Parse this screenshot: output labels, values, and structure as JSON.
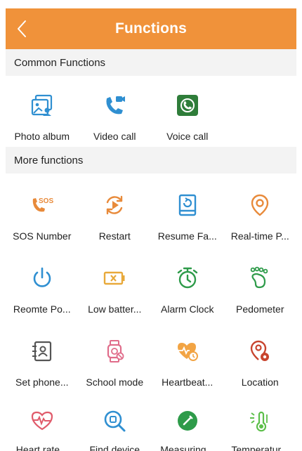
{
  "header": {
    "title": "Functions",
    "color": "#f0923a"
  },
  "sections": {
    "common": "Common Functions",
    "more": "More functions"
  },
  "common": [
    {
      "label": "Photo album",
      "icon": "photo-album-icon"
    },
    {
      "label": "Video call",
      "icon": "video-call-icon"
    },
    {
      "label": "Voice call",
      "icon": "voice-call-icon"
    }
  ],
  "more": [
    {
      "label": "SOS Number",
      "icon": "sos-icon"
    },
    {
      "label": "Restart",
      "icon": "restart-icon"
    },
    {
      "label": "Resume Fa...",
      "icon": "factory-reset-icon"
    },
    {
      "label": "Real-time P...",
      "icon": "location-pin-icon"
    },
    {
      "label": "Reomte Po...",
      "icon": "power-icon"
    },
    {
      "label": "Low batter...",
      "icon": "low-battery-icon"
    },
    {
      "label": "Alarm Clock",
      "icon": "alarm-clock-icon"
    },
    {
      "label": "Pedometer",
      "icon": "footprint-icon"
    },
    {
      "label": "Set phone...",
      "icon": "phonebook-icon"
    },
    {
      "label": "School mode",
      "icon": "watch-icon"
    },
    {
      "label": "Heartbeat...",
      "icon": "heartbeat-icon"
    },
    {
      "label": "Location",
      "icon": "location-settings-icon"
    },
    {
      "label": "Heart rate...",
      "icon": "heart-rate-icon"
    },
    {
      "label": "Find device",
      "icon": "find-device-icon"
    },
    {
      "label": "Measuring...",
      "icon": "measuring-icon"
    },
    {
      "label": "Temperatur...",
      "icon": "thermometer-icon"
    }
  ]
}
